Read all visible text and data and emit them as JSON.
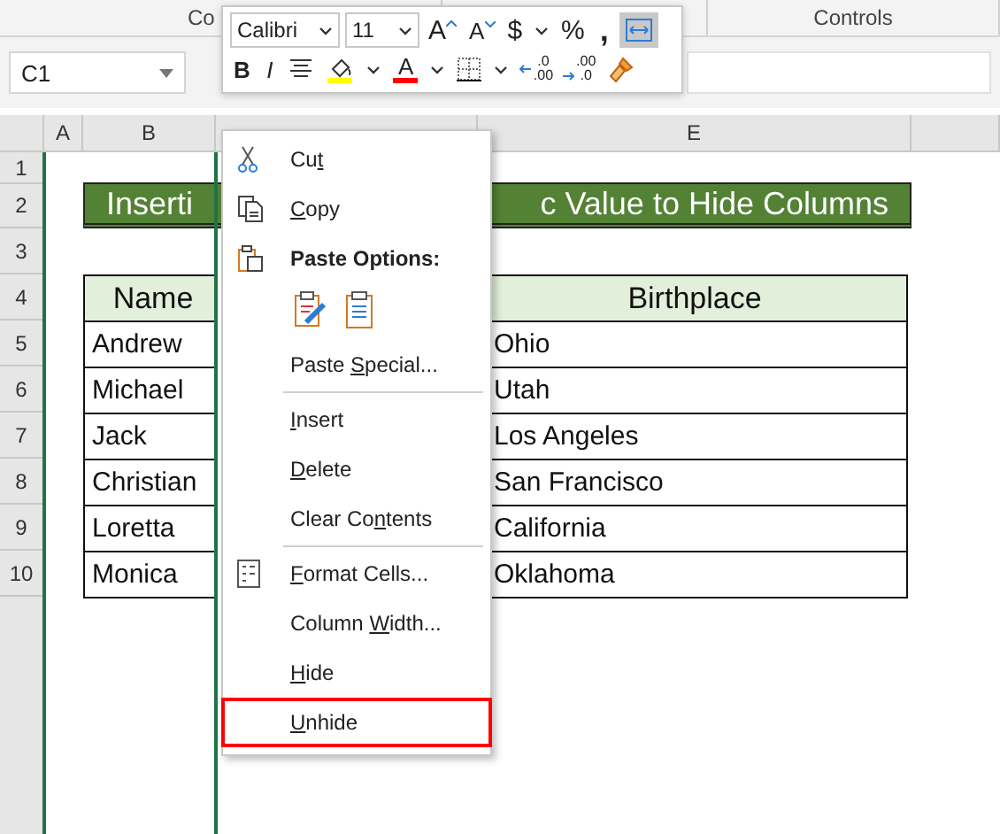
{
  "ribbon": {
    "left_group": "Co",
    "right_group": "Controls"
  },
  "name_box": {
    "value": "C1"
  },
  "column_headers": {
    "column_1": "A",
    "column_2": "B",
    "column_4": "E"
  },
  "row_numbers": [
    "1",
    "2",
    "3",
    "4",
    "5",
    "6",
    "7",
    "8",
    "9",
    "10"
  ],
  "title": {
    "left": "Inserti",
    "right": "c Value to Hide Columns"
  },
  "table": {
    "columns": [
      "Name",
      "Birthplace"
    ],
    "rows": [
      [
        "Andrew",
        "Ohio"
      ],
      [
        "Michael",
        "Utah"
      ],
      [
        "Jack",
        "Los Angeles"
      ],
      [
        "Christian",
        "San Francisco"
      ],
      [
        "Loretta",
        "California"
      ],
      [
        "Monica",
        "Oklahoma"
      ]
    ]
  },
  "mini_toolbar": {
    "font_row": [
      {
        "kind": "font-box",
        "label": "Calibri",
        "pressed": false
      },
      {
        "kind": "size-box",
        "label": "11",
        "pressed": false
      },
      {
        "kind": "grow",
        "label": "A",
        "pressed": false
      },
      {
        "kind": "shrink",
        "label": "A",
        "pressed": false
      },
      {
        "kind": "glyph",
        "label": "$",
        "pressed": false
      },
      {
        "kind": "caret",
        "pressed": false
      },
      {
        "kind": "glyph",
        "label": "%",
        "pressed": false
      },
      {
        "kind": "comma",
        "label": ",",
        "pressed": false
      },
      {
        "kind": "wrap",
        "pressed": true
      }
    ],
    "format_row": [
      {
        "kind": "bold",
        "label": "B",
        "pressed": false
      },
      {
        "kind": "italic",
        "label": "I",
        "pressed": false
      },
      {
        "kind": "align",
        "pressed": false
      },
      {
        "kind": "fill",
        "pressed": false
      },
      {
        "kind": "caret",
        "pressed": false
      },
      {
        "kind": "font-color",
        "label": "A",
        "pressed": false
      },
      {
        "kind": "caret",
        "pressed": false
      },
      {
        "kind": "borders",
        "pressed": false
      },
      {
        "kind": "caret",
        "pressed": false
      },
      {
        "kind": "add-decimal",
        "lines": [
          ".0",
          ".00"
        ],
        "pressed": false
      },
      {
        "kind": "remove-decimal",
        "lines": [
          ".00",
          ".0"
        ],
        "pressed": false
      },
      {
        "kind": "painter",
        "pressed": false
      }
    ]
  },
  "context_menu": [
    {
      "kind": "item",
      "before": "Cu",
      "key": "t",
      "highlighted": false
    },
    {
      "kind": "item",
      "key": "C",
      "after": "opy",
      "highlighted": false
    },
    {
      "kind": "header",
      "label": "Paste Options:"
    },
    {
      "kind": "paste-icons"
    },
    {
      "kind": "item",
      "before": "Paste ",
      "key": "S",
      "after": "pecial...",
      "highlighted": false
    },
    {
      "kind": "separator"
    },
    {
      "kind": "item",
      "key": "I",
      "after": "nsert",
      "highlighted": false
    },
    {
      "kind": "item",
      "key": "D",
      "after": "elete",
      "highlighted": false
    },
    {
      "kind": "item",
      "before": "Clear Co",
      "key": "n",
      "after": "tents",
      "highlighted": false
    },
    {
      "kind": "separator"
    },
    {
      "kind": "item",
      "key": "F",
      "after": "ormat Cells...",
      "highlighted": false
    },
    {
      "kind": "item",
      "before": "Column ",
      "key": "W",
      "after": "idth...",
      "highlighted": false
    },
    {
      "kind": "item",
      "key": "H",
      "after": "ide",
      "highlighted": false
    },
    {
      "kind": "item",
      "key": "U",
      "after": "nhide",
      "highlighted": true
    }
  ]
}
